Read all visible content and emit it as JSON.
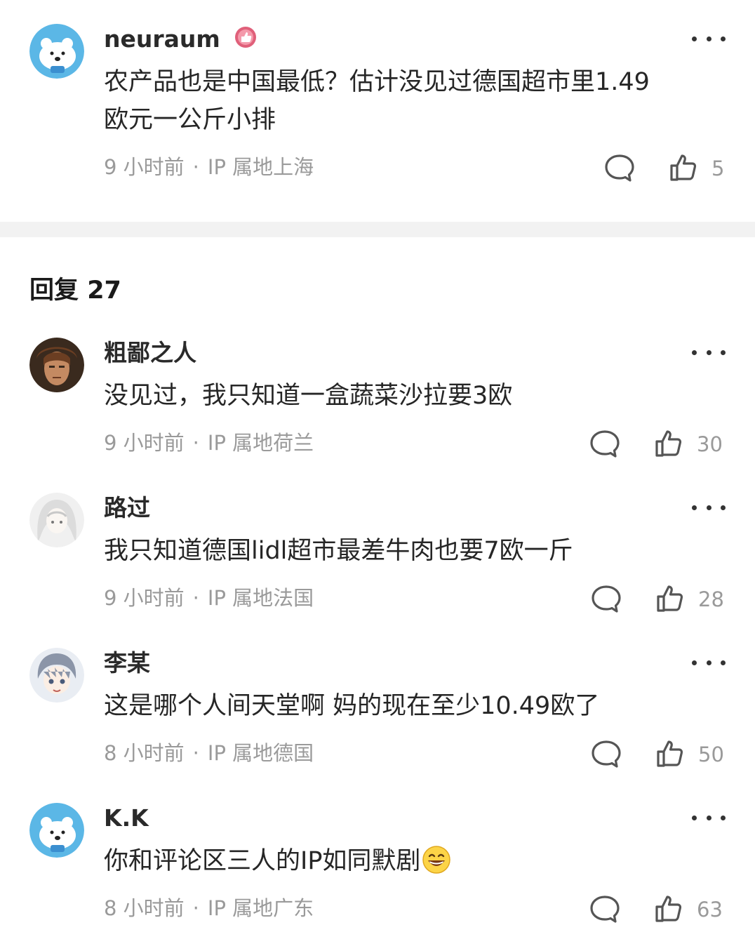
{
  "main_comment": {
    "username": "neuraum",
    "text_line1": "农产品也是中国最低？估计没见过德国超市里1.49",
    "text_line2": "欧元一公斤小排",
    "time": "9 小时前",
    "location": "IP 属地上海",
    "likes": "5"
  },
  "replies_header": {
    "label": "回复",
    "count": "27"
  },
  "replies": [
    {
      "username": "粗鄙之人",
      "text": "没见过，我只知道一盒蔬菜沙拉要3欧",
      "time": "9 小时前",
      "location": "IP 属地荷兰",
      "likes": "30"
    },
    {
      "username": "路过",
      "text": "我只知道德国lidl超市最差牛肉也要7欧一斤",
      "time": "9 小时前",
      "location": "IP 属地法国",
      "likes": "28"
    },
    {
      "username": "李某",
      "text": "这是哪个人间天堂啊 妈的现在至少10.49欧了",
      "time": "8 小时前",
      "location": "IP 属地德国",
      "likes": "50"
    },
    {
      "username": "K.K",
      "text": "你和评论区三人的IP如同默剧",
      "time": "8 小时前",
      "location": "IP 属地广东",
      "likes": "63",
      "emoji": "grinning-emoji"
    }
  ],
  "meta_separator": "·",
  "icons": {
    "badge": "like-badge-icon",
    "more": "more-dots-icon",
    "comment": "comment-bubble-icon",
    "like": "thumbs-up-icon"
  },
  "colors": {
    "badge": "#e0607a",
    "meta_gray": "#9a9a9a",
    "divider": "#f2f2f2"
  }
}
